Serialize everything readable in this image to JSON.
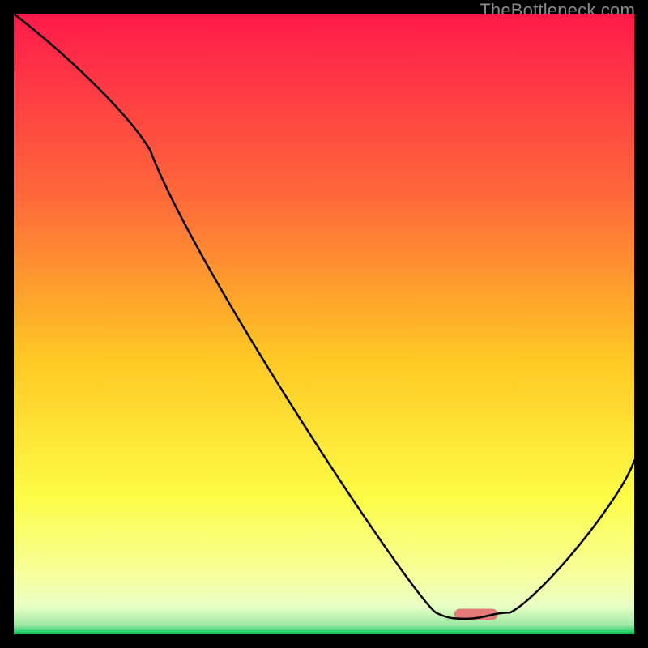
{
  "watermark": "TheBottleneck.com",
  "chart_data": {
    "type": "line",
    "title": "",
    "xlabel": "",
    "ylabel": "",
    "xlim": [
      0,
      100
    ],
    "ylim": [
      0,
      100
    ],
    "grid": false,
    "legend": false,
    "background_gradient_stops": [
      {
        "pct": 0.0,
        "color": "#ff1a4b"
      },
      {
        "pct": 0.3,
        "color": "#ff6a3a"
      },
      {
        "pct": 0.55,
        "color": "#ffc624"
      },
      {
        "pct": 0.78,
        "color": "#fdfc47"
      },
      {
        "pct": 0.9,
        "color": "#f7ff9a"
      },
      {
        "pct": 0.955,
        "color": "#e9ffc4"
      },
      {
        "pct": 0.985,
        "color": "#9fe9a6"
      },
      {
        "pct": 1.0,
        "color": "#00c853"
      }
    ],
    "series": [
      {
        "name": "bottleneck-curve",
        "x": [
          0,
          22,
          68,
          73,
          80,
          100
        ],
        "values": [
          100,
          78,
          3.5,
          2.5,
          3.5,
          28
        ]
      }
    ],
    "marker": {
      "x_start": 71,
      "x_end": 78,
      "y": 3.2,
      "color": "#e47a7a"
    }
  }
}
